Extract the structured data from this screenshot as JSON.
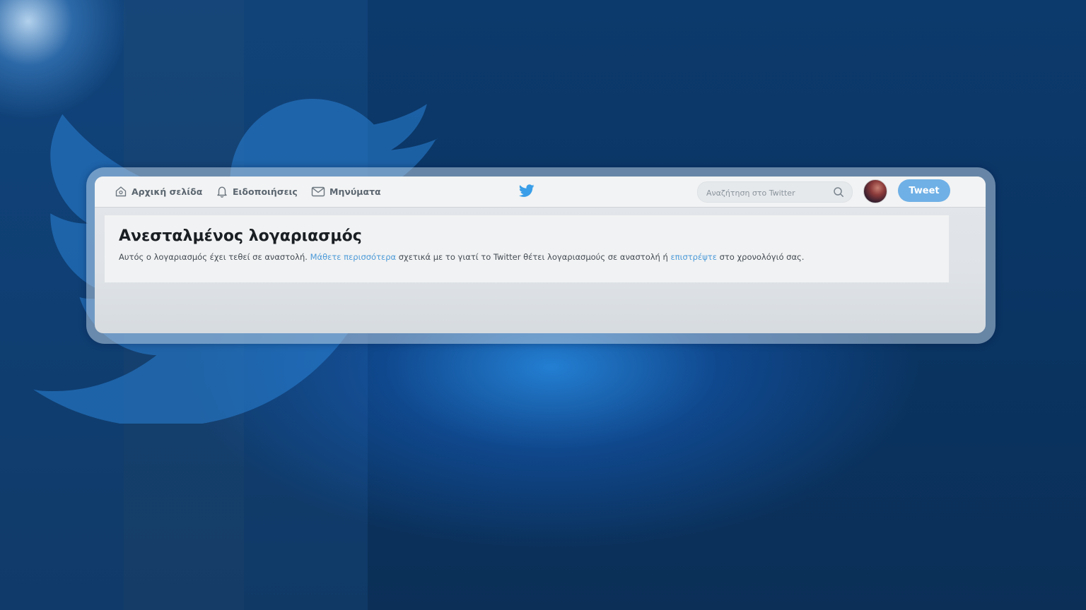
{
  "background": {
    "accent": "#1d8ef0",
    "bird_icon": "twitter-bird-icon"
  },
  "nav": {
    "items": [
      {
        "label": "Αρχική σελίδα",
        "icon": "home-icon"
      },
      {
        "label": "Ειδοποιήσεις",
        "icon": "bell-icon"
      },
      {
        "label": "Μηνύματα",
        "icon": "envelope-icon"
      }
    ],
    "logo_icon": "twitter-bird-icon"
  },
  "search": {
    "placeholder": "Αναζήτηση στο Twitter",
    "icon": "search-icon"
  },
  "tweet_button": {
    "label": "Tweet",
    "color": "#6fb0e6"
  },
  "main": {
    "title": "Ανεσταλμένος λογαριασμός",
    "message": {
      "part1": "Αυτός ο λογαριασμός έχει τεθεί σε αναστολή. ",
      "link1": "Μάθετε περισσότερα",
      "part2": " σχετικά με το γιατί το Twitter θέτει λογαριασμούς σε αναστολή ή ",
      "link2": "επιστρέψτε",
      "part3": " στο χρονολόγιό σας."
    }
  },
  "colors": {
    "link": "#4b9ad8",
    "twitter_blue": "#3a9ee8"
  }
}
